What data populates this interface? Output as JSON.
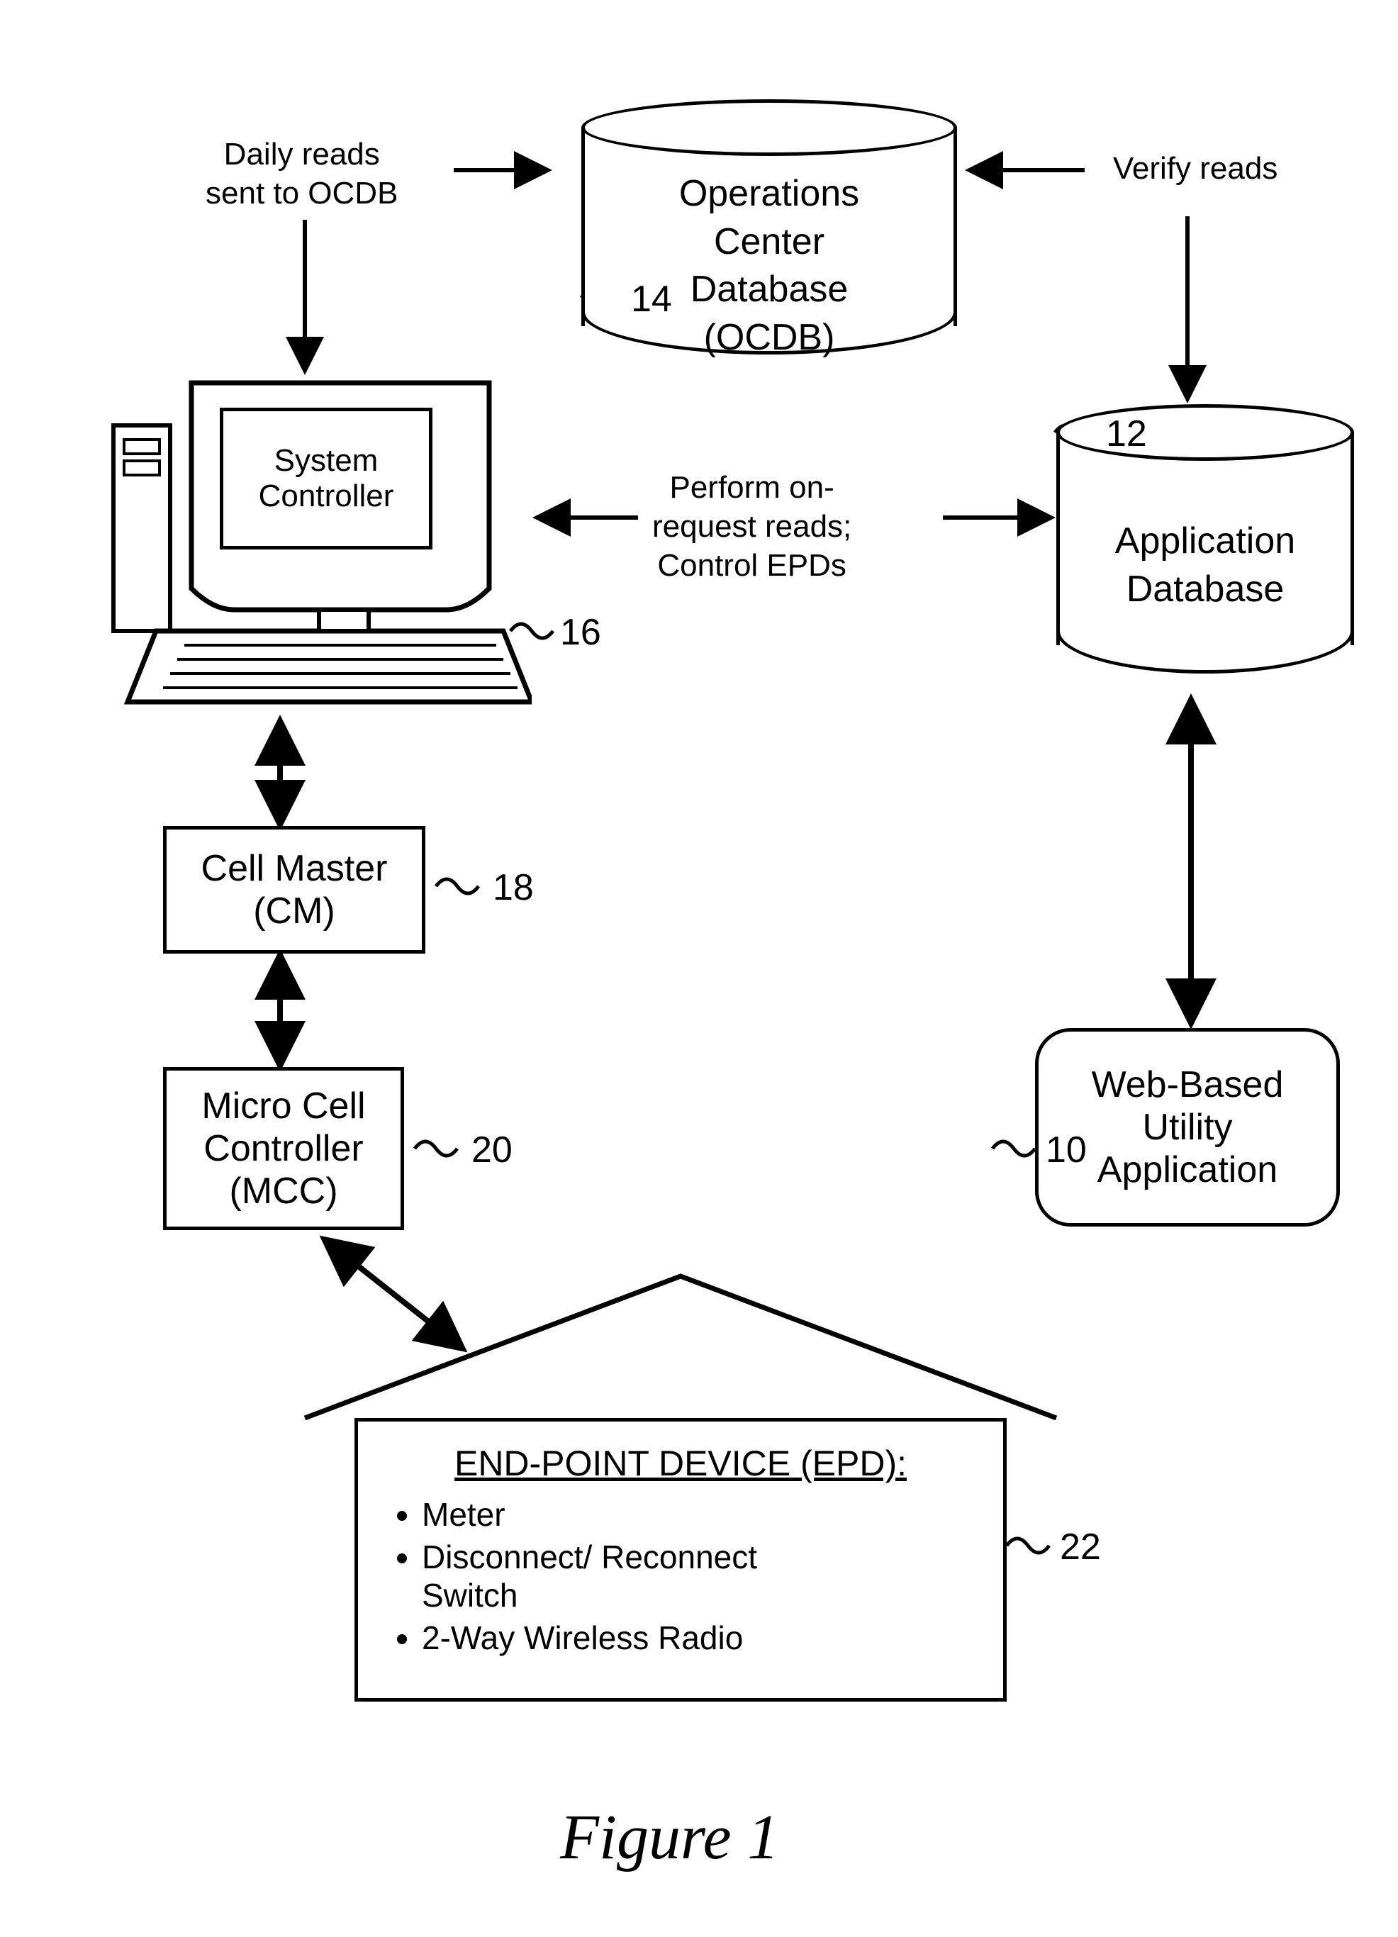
{
  "labels": {
    "daily_reads": "Daily reads\nsent to OCDB",
    "verify_reads": "Verify reads",
    "on_request": "Perform on-\nrequest reads;\nControl EPDs"
  },
  "ocdb": {
    "line1": "Operations",
    "line2": "Center",
    "line3": "Database",
    "line4": "(OCDB)"
  },
  "app_db": {
    "line1": "Application",
    "line2": "Database"
  },
  "system_controller": "System\nController",
  "cell_master": {
    "line1": "Cell Master",
    "line2": "(CM)"
  },
  "mcc": {
    "line1": "Micro Cell",
    "line2": "Controller",
    "line3": "(MCC)"
  },
  "web_app": {
    "line1": "Web-Based",
    "line2": "Utility",
    "line3": "Application"
  },
  "epd": {
    "title": "END-POINT DEVICE (EPD):",
    "item1": "Meter",
    "item2": "Disconnect/ Reconnect\nSwitch",
    "item3": "2-Way Wireless Radio"
  },
  "refs": {
    "r10": "10",
    "r12": "12",
    "r14": "14",
    "r16": "16",
    "r18": "18",
    "r20": "20",
    "r22": "22"
  },
  "figure_title": "Figure 1"
}
